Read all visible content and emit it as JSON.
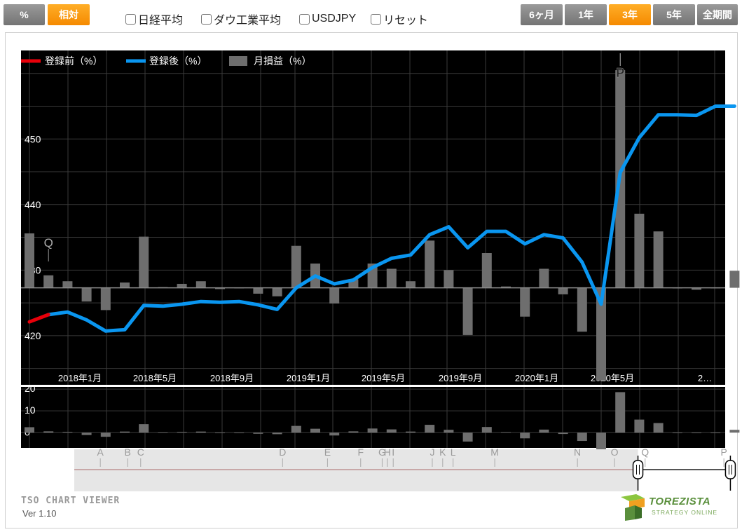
{
  "toolbar": {
    "mode_buttons": [
      {
        "label": "%",
        "active": false
      },
      {
        "label": "相対",
        "active": true
      }
    ],
    "checkboxes": [
      {
        "label": "日経平均",
        "checked": false
      },
      {
        "label": "ダウ工業平均",
        "checked": false
      },
      {
        "label": "USDJPY",
        "checked": false
      },
      {
        "label": "リセット",
        "checked": false
      }
    ],
    "period_buttons": [
      {
        "label": "6ヶ月",
        "active": false
      },
      {
        "label": "1年",
        "active": false
      },
      {
        "label": "3年",
        "active": true
      },
      {
        "label": "5年",
        "active": false
      },
      {
        "label": "全期間",
        "active": false
      }
    ]
  },
  "colors": {
    "before": "#e8000a",
    "after": "#0a96f0",
    "bars": "#6e6e6e",
    "accent": "#f58a00"
  },
  "chart_data": [
    {
      "type": "line",
      "legend": [
        "登録前（%）",
        "登録後（%）",
        "月損益（%）"
      ],
      "y_tick_labels": [
        "450",
        "440",
        "430",
        "420"
      ],
      "x_tick_labels": [
        "2018年1月",
        "2018年5月",
        "2018年9月",
        "2019年1月",
        "2019年5月",
        "2019年9月",
        "2020年1月",
        "2020年5月",
        "2…"
      ],
      "ylim": [
        412.5,
        463.5
      ],
      "zero_line": 427.3,
      "grid": true,
      "series": [
        {
          "name": "登録前（%）",
          "x": [
            0,
            1
          ],
          "values": [
            422.1,
            423.2
          ]
        },
        {
          "name": "登録後（%）",
          "x": [
            1,
            2,
            3,
            4,
            5,
            6,
            7,
            8,
            9,
            10,
            11,
            12,
            13,
            14,
            15,
            16,
            17,
            18,
            19,
            20,
            21,
            22,
            23,
            24,
            25,
            26,
            27,
            28,
            29,
            30,
            31,
            32,
            33,
            34,
            35,
            36,
            37
          ],
          "values": [
            423.2,
            423.6,
            422.4,
            420.7,
            420.9,
            424.6,
            424.5,
            424.8,
            425.2,
            425.1,
            425.2,
            424.7,
            424.0,
            427.3,
            429.1,
            427.9,
            428.5,
            430.4,
            431.8,
            432.3,
            435.4,
            436.6,
            433.4,
            435.9,
            435.9,
            434.0,
            435.4,
            434.9,
            431.2,
            424.8,
            444.9,
            450.2,
            453.7,
            453.7,
            453.6,
            455.0,
            455.0
          ]
        },
        {
          "name": "月損益（%）",
          "x": [
            0,
            1,
            2,
            3,
            4,
            5,
            6,
            7,
            8,
            9,
            10,
            11,
            12,
            13,
            14,
            15,
            16,
            17,
            18,
            19,
            20,
            21,
            22,
            23,
            24,
            25,
            26,
            27,
            28,
            29,
            30,
            31,
            32,
            33,
            34,
            35,
            36,
            37
          ],
          "values": [
            8.3,
            1.9,
            1.0,
            -2.1,
            -3.4,
            0.8,
            7.8,
            0.1,
            0.6,
            1.0,
            -0.2,
            0.0,
            -0.9,
            -1.3,
            6.4,
            3.7,
            -2.4,
            1.3,
            3.7,
            2.9,
            1.0,
            7.2,
            2.7,
            -7.2,
            5.3,
            0.2,
            -4.4,
            2.9,
            -1.0,
            -6.7,
            -14.2,
            33.2,
            11.3,
            8.6,
            -0.1,
            -0.3,
            0.0,
            2.6
          ]
        }
      ],
      "annotations": [
        {
          "text": "Q",
          "x": 1
        },
        {
          "text": "P",
          "x": 31
        }
      ]
    },
    {
      "type": "bar",
      "y_tick_labels": [
        "20",
        "10",
        "0"
      ],
      "ylim": [
        -7.0,
        21.0
      ],
      "values": [
        2.5,
        0.6,
        0.3,
        -1.1,
        -1.9,
        0.5,
        3.9,
        0.1,
        0.3,
        0.5,
        -0.1,
        0.0,
        -0.5,
        -0.7,
        3.1,
        1.8,
        -1.3,
        0.6,
        1.9,
        1.5,
        0.5,
        3.6,
        1.3,
        -4.1,
        2.6,
        0.2,
        -2.6,
        1.4,
        -0.6,
        -3.8,
        -8.1,
        18.6,
        6.0,
        4.4,
        -0.1,
        -0.2,
        0.0,
        1.3
      ]
    }
  ],
  "navigator": {
    "event_labels": [
      "A",
      "B",
      "C",
      "D",
      "E",
      "F",
      "G",
      "H",
      "I",
      "J",
      "K",
      "L",
      "M",
      "N",
      "O",
      "Q",
      "P"
    ],
    "event_x": [
      4.0,
      8.2,
      10.2,
      32.0,
      38.9,
      44.0,
      47.3,
      48.1,
      49.0,
      55.0,
      56.6,
      58.2,
      64.6,
      77.3,
      83.0,
      87.7,
      99.8
    ],
    "window": [
      86.6,
      100.8
    ]
  },
  "footer": {
    "viewer_title": "TSO CHART VIEWER",
    "version": "Ver 1.10",
    "logo_name": "TOREZISTA",
    "logo_tagline": "STRATEGY ONLINE"
  }
}
